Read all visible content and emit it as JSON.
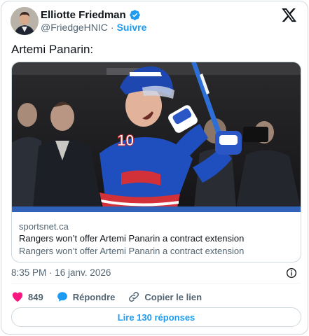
{
  "author": {
    "name": "Elliotte Friedman",
    "handle": "@FriedgeHNIC",
    "separator": "·",
    "follow_label": "Suivre"
  },
  "tweet": {
    "text": "Artemi Panarin:"
  },
  "link_card": {
    "domain": "sportsnet.ca",
    "title": "Rangers won’t offer Artemi Panarin a contract extension",
    "description": "Rangers won’t offer Artemi Panarin a contract extension",
    "photo_jersey_number": "10"
  },
  "meta": {
    "timestamp": "8:35 PM · 16 janv. 2026"
  },
  "actions": {
    "like_count": "849",
    "reply_label": "Répondre",
    "copy_link_label": "Copier le lien"
  },
  "read_replies_label": "Lire 130 réponses",
  "colors": {
    "accent": "#1d9bf0",
    "like": "#f91880",
    "text": "#0f1419",
    "muted": "#536471",
    "border": "#cfd9de"
  },
  "icons": [
    "verified-badge-icon",
    "x-logo-icon",
    "info-icon",
    "heart-icon",
    "reply-bubble-icon",
    "link-icon"
  ]
}
